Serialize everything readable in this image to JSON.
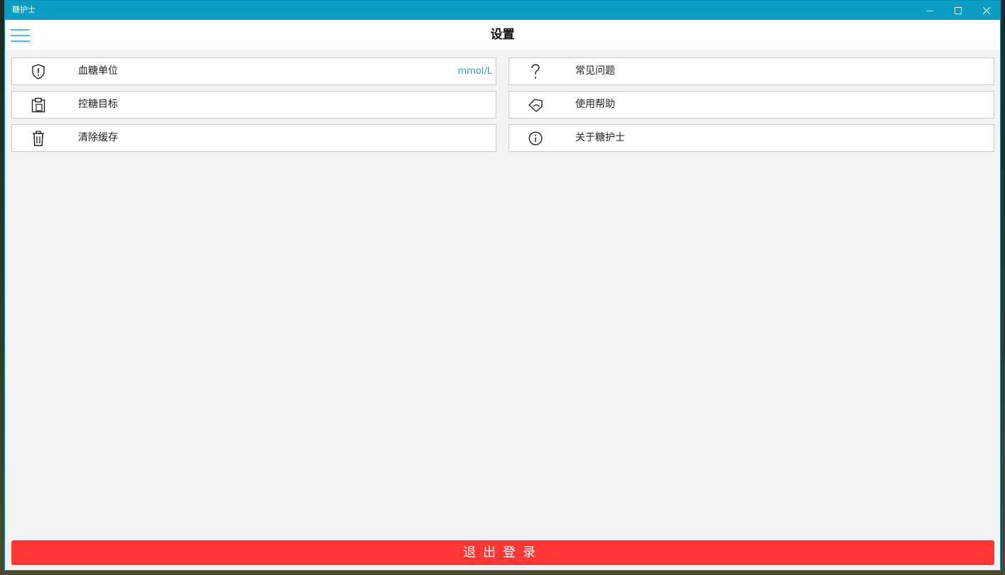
{
  "window": {
    "title": "糖护士",
    "accent_color": "#0a9cc2"
  },
  "header": {
    "menu_icon": "hamburger-menu-icon",
    "title": "设置"
  },
  "settings_left": [
    {
      "icon": "shield-alert-icon",
      "label": "血糖单位",
      "value": "mmol/L"
    },
    {
      "icon": "clipboard-target-icon",
      "label": "控糖目标",
      "value": ""
    },
    {
      "icon": "trash-icon",
      "label": "清除缓存",
      "value": ""
    }
  ],
  "settings_right": [
    {
      "icon": "question-mark-icon",
      "label": "常见问题"
    },
    {
      "icon": "tag-help-icon",
      "label": "使用帮助"
    },
    {
      "icon": "info-icon",
      "label": "关于糖护士"
    }
  ],
  "logout": {
    "label": "退出登录",
    "color": "#ff3636"
  }
}
